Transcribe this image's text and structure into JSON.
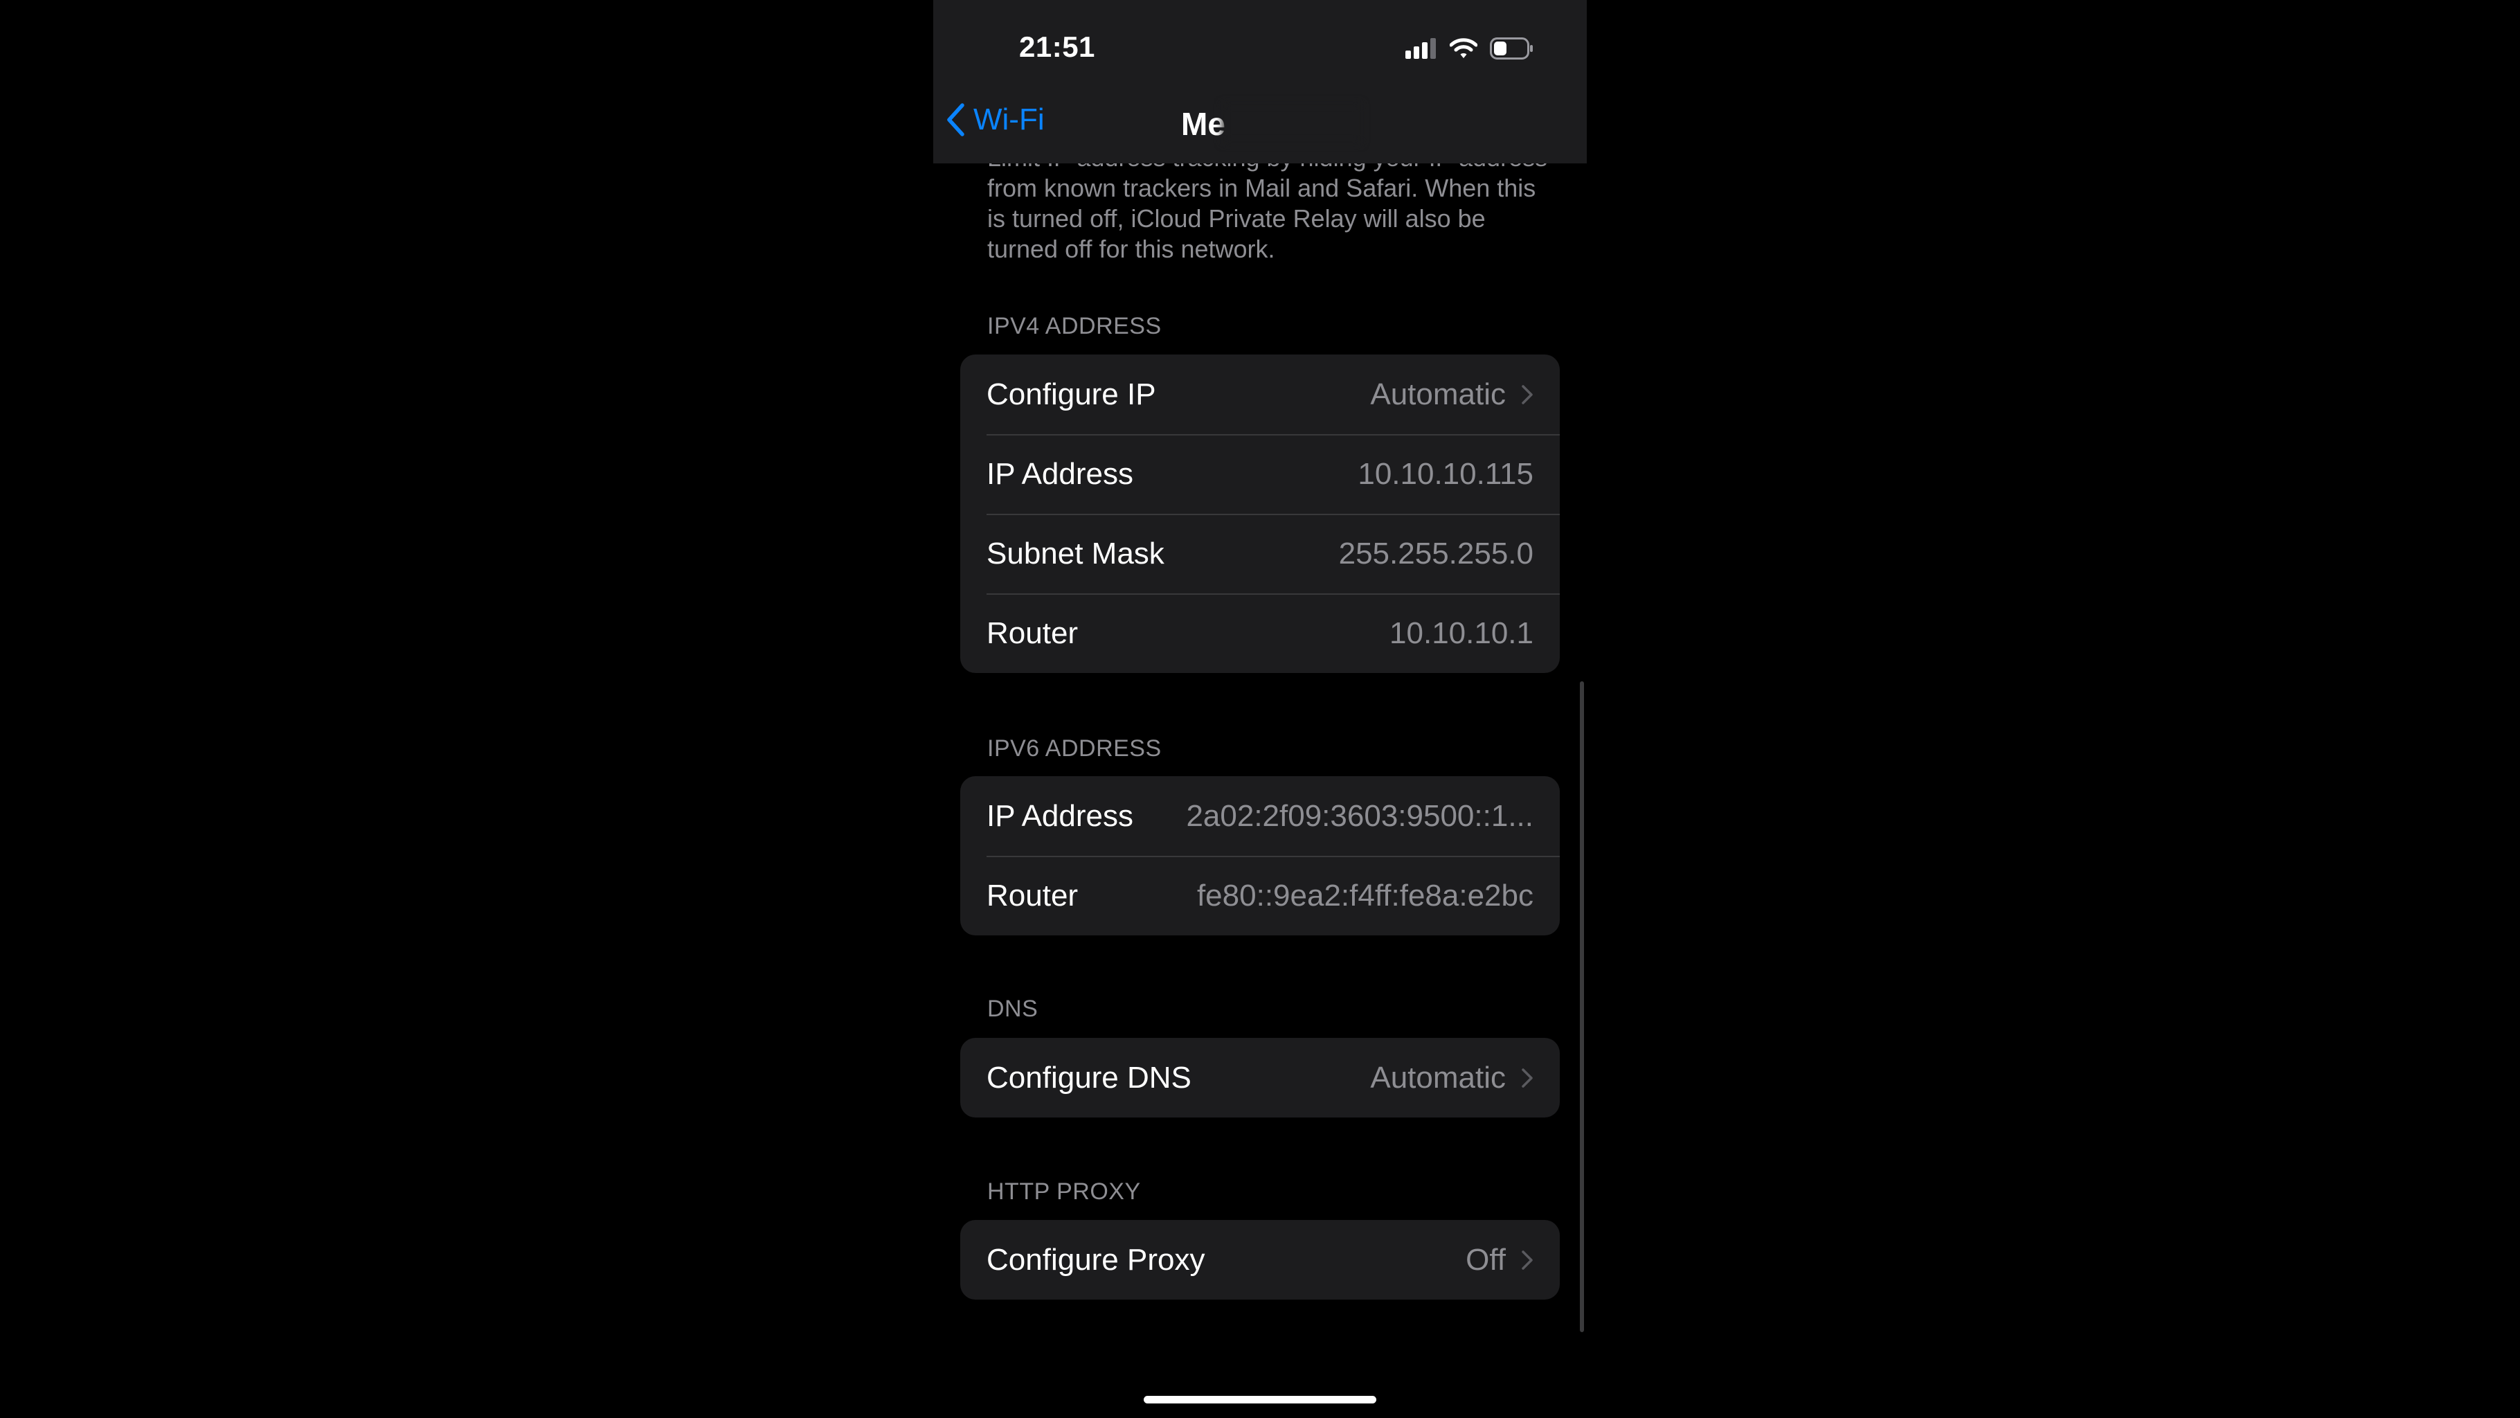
{
  "status_bar": {
    "time": "21:51",
    "icons": [
      "cellular-signal-icon",
      "wifi-icon",
      "battery-icon"
    ]
  },
  "nav": {
    "back_label": "Wi-Fi",
    "title": "Me"
  },
  "footnote": "Limit IP address tracking by hiding your IP address from known trackers in Mail and Safari. When this is turned off, iCloud Private Relay will also be turned off for this network.",
  "ipv4": {
    "header": "IPV4 ADDRESS",
    "rows": [
      {
        "label": "Configure IP",
        "value": "Automatic"
      },
      {
        "label": "IP Address",
        "value": "10.10.10.115"
      },
      {
        "label": "Subnet Mask",
        "value": "255.255.255.0"
      },
      {
        "label": "Router",
        "value": "10.10.10.1"
      }
    ]
  },
  "ipv6": {
    "header": "IPV6 ADDRESS",
    "rows": [
      {
        "label": "IP Address",
        "value": "2a02:2f09:3603:9500::1..."
      },
      {
        "label": "Router",
        "value": "fe80::9ea2:f4ff:fe8a:e2bc"
      }
    ]
  },
  "dns": {
    "header": "DNS",
    "rows": [
      {
        "label": "Configure DNS",
        "value": "Automatic"
      }
    ]
  },
  "http_proxy": {
    "header": "HTTP PROXY",
    "rows": [
      {
        "label": "Configure Proxy",
        "value": "Off"
      }
    ]
  },
  "colors": {
    "accent": "#0a84ff",
    "background": "#000000",
    "group_background": "#1c1c1e",
    "secondary_text": "#8e8e93"
  }
}
